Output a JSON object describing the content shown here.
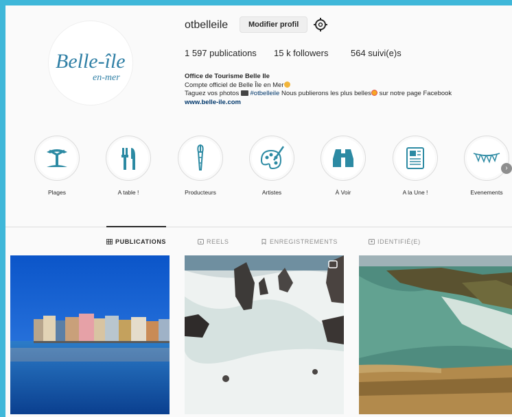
{
  "profile": {
    "username": "otbelleile",
    "edit_label": "Modifier profil",
    "settings_icon": "gear-icon",
    "logo": {
      "line1": "Belle-île",
      "line2": "en-mer"
    },
    "stats": {
      "publications": "1 597 publications",
      "followers": "15 k followers",
      "following": "564 suivi(e)s"
    },
    "bio": {
      "name": "Office de Tourisme Belle Ile",
      "line1": "Compte officiel de Belle Île en Mer",
      "line2_a": "Taguez vos photos",
      "line2_tag": "#otbelleile",
      "line2_b": "Nous publierons les plus belles",
      "line2_c": "sur notre page Facebook",
      "website": "www.belle-ile.com"
    }
  },
  "highlights": [
    {
      "label": "Plages",
      "icon": "palm-tree-icon"
    },
    {
      "label": "A table !",
      "icon": "fork-knife-icon"
    },
    {
      "label": "Producteurs",
      "icon": "carrot-icon"
    },
    {
      "label": "Artistes",
      "icon": "palette-icon"
    },
    {
      "label": "À Voir",
      "icon": "binoculars-icon"
    },
    {
      "label": "A la Une !",
      "icon": "newspaper-icon"
    },
    {
      "label": "Evenements",
      "icon": "bunting-icon"
    }
  ],
  "tabs": [
    {
      "label": "PUBLICATIONS",
      "icon": "grid-icon",
      "active": true
    },
    {
      "label": "REELS",
      "icon": "reels-icon"
    },
    {
      "label": "ENREGISTREMENTS",
      "icon": "bookmark-icon"
    },
    {
      "label": "IDENTIFIÉ(E)",
      "icon": "tagged-icon"
    }
  ],
  "colors": {
    "brand_teal": "#2f7fa5",
    "highlight_teal": "#2c8aa3",
    "link": "#00376b"
  }
}
